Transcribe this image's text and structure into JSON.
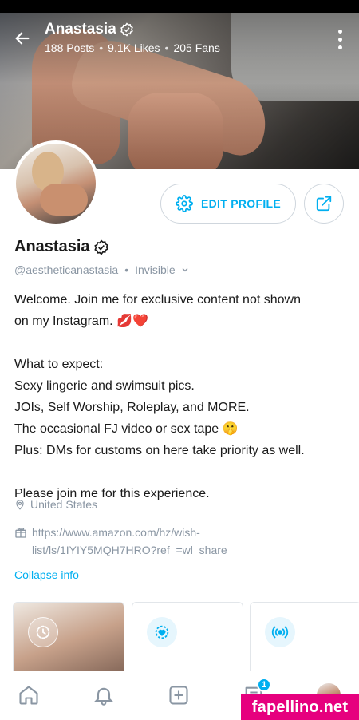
{
  "header": {
    "name": "Anastasia",
    "posts": "188 Posts",
    "likes": "9.1K Likes",
    "fans": "205 Fans",
    "separator": "•"
  },
  "profile": {
    "name": "Anastasia",
    "handle": "@aestheticanastasia",
    "separator": "•",
    "status": "Invisible",
    "edit_label": "EDIT PROFILE",
    "bio": {
      "line1": "Welcome. Join me for exclusive content not shown",
      "line2": "on my Instagram. 💋❤️",
      "line3": "What to expect:",
      "line4": "Sexy lingerie and swimsuit pics.",
      "line5": "JOIs, Self Worship, Roleplay, and MORE.",
      "line6": "The occasional FJ video or sex tape 🤫",
      "line7": "Plus: DMs for customs on here take priority as well.",
      "line8": "Please join me for this experience."
    },
    "location": "United States",
    "wishlist_line1": "https://www.amazon.com/hz/wish-",
    "wishlist_line2": "list/ls/1IYIY5MQH7HRO?ref_=wl_share",
    "collapse_label": "Collapse info"
  },
  "bottom_nav": {
    "messages_badge": "1"
  },
  "watermark": "fapellino.net",
  "colors": {
    "accent": "#00aff0",
    "muted": "#8a96a3",
    "text": "#1a1a1a",
    "watermark_bg": "#e6007e"
  },
  "icons": {
    "back": "arrow-left-icon",
    "verified": "verified-badge-icon",
    "menu": "kebab-menu-icon",
    "settings": "gear-icon",
    "share": "share-icon",
    "status_chevron": "chevron-down-icon",
    "location": "location-pin-icon",
    "wishlist": "gift-icon",
    "stories": "clock-history-icon",
    "highlight": "heart-badge-icon",
    "live": "broadcast-icon",
    "home": "home-icon",
    "notifications": "bell-icon",
    "add": "plus-square-icon",
    "messages": "message-icon",
    "avatar": "user-avatar"
  }
}
